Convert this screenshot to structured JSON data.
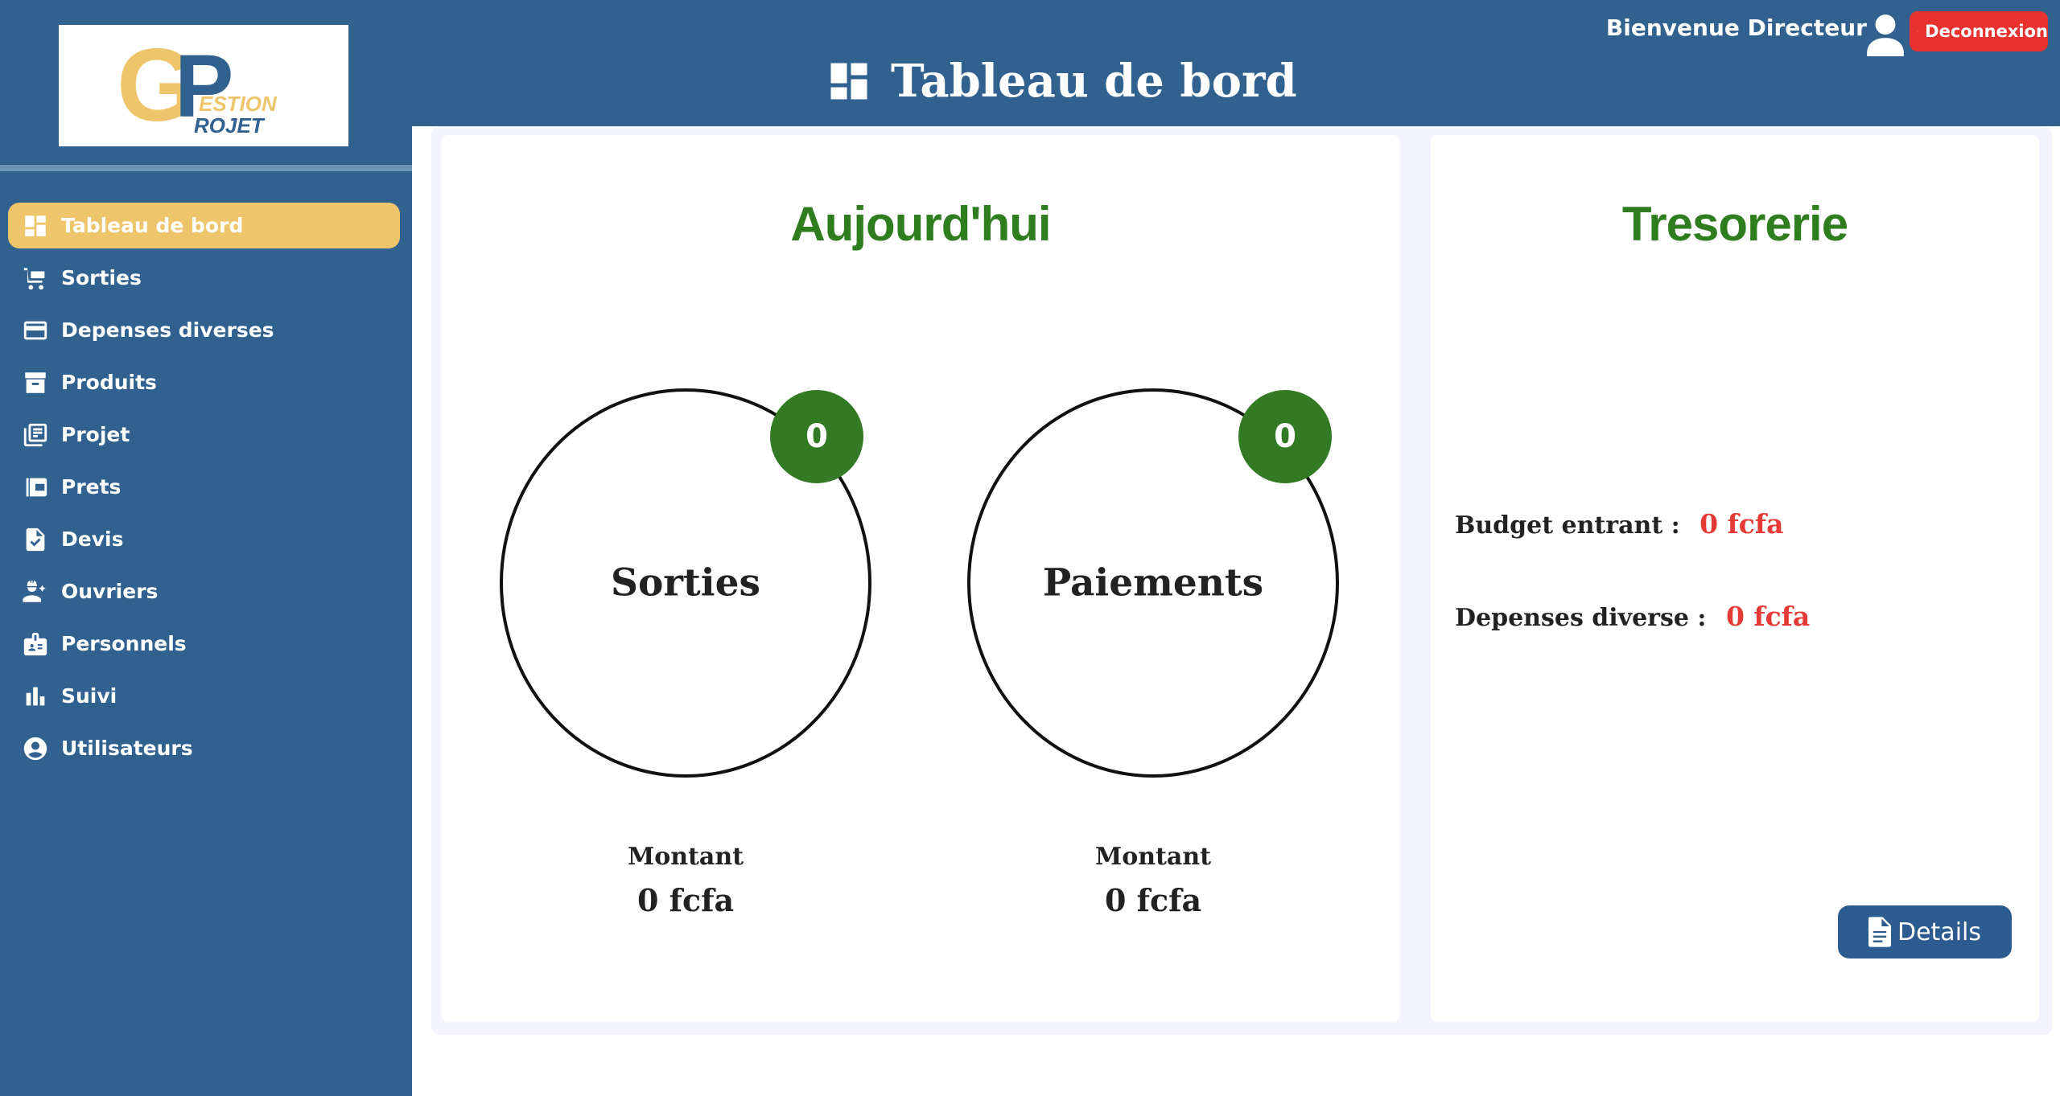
{
  "logo": {
    "letters": "GP",
    "word1": "ESTION",
    "word2": "ROJET"
  },
  "header": {
    "title": "Tableau de bord",
    "welcome": "Bienvenue Directeur",
    "logout_label": "Deconnexion"
  },
  "sidebar": {
    "items": [
      {
        "label": "Tableau de bord",
        "icon": "dashboard-icon"
      },
      {
        "label": "Sorties",
        "icon": "cart-icon"
      },
      {
        "label": "Depenses diverses",
        "icon": "credit-card-icon"
      },
      {
        "label": "Produits",
        "icon": "archive-box-icon"
      },
      {
        "label": "Projet",
        "icon": "library-books-icon"
      },
      {
        "label": "Prets",
        "icon": "wallet-icon"
      },
      {
        "label": "Devis",
        "icon": "document-check-icon"
      },
      {
        "label": "Ouvriers",
        "icon": "worker-icon"
      },
      {
        "label": "Personnels",
        "icon": "id-badge-icon"
      },
      {
        "label": "Suivi",
        "icon": "bar-chart-icon"
      },
      {
        "label": "Utilisateurs",
        "icon": "account-circle-icon"
      }
    ]
  },
  "today": {
    "title": "Aujourd'hui",
    "sorties": {
      "label": "Sorties",
      "count": "0",
      "amount_label": "Montant",
      "amount": "0 fcfa"
    },
    "paiements": {
      "label": "Paiements",
      "count": "0",
      "amount_label": "Montant",
      "amount": "0 fcfa"
    }
  },
  "tresorerie": {
    "title": "Tresorerie",
    "budget_label": "Budget entrant :",
    "budget_value": "0 fcfa",
    "depenses_label": "Depenses diverse :",
    "depenses_value": "0 fcfa",
    "details_label": "Details"
  },
  "colors": {
    "primary": "#30618f",
    "accent": "#eec56a",
    "green": "#327a23",
    "red": "#e8322f"
  }
}
